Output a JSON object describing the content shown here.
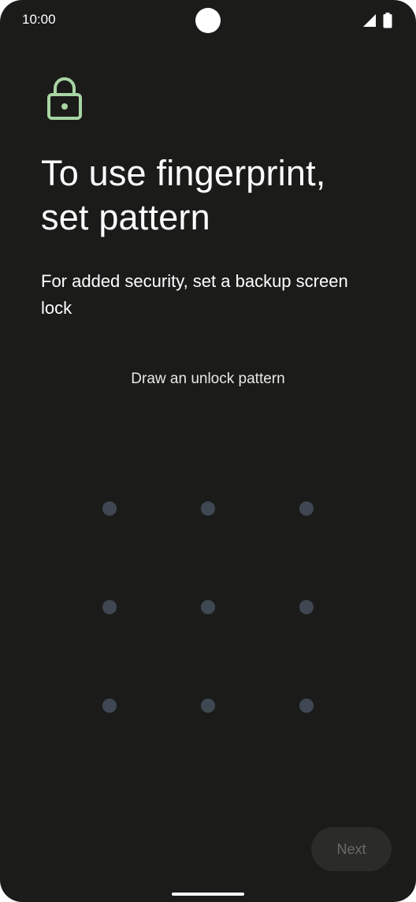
{
  "status_bar": {
    "time": "10:00",
    "icons": [
      "signal-icon",
      "battery-icon"
    ]
  },
  "header": {
    "icon": "lock-icon",
    "title_line1": "To use fingerprint,",
    "title_line2": "set pattern",
    "subtitle": "For added security, set a backup screen lock"
  },
  "pattern": {
    "instruction": "Draw an unlock pattern",
    "rows": 3,
    "cols": 3
  },
  "footer": {
    "next_label": "Next"
  },
  "colors": {
    "background": "#1b1c1a",
    "accent": "#a8d5a3",
    "dot": "#3f4852",
    "button_bg": "#2b2c2a",
    "button_text_disabled": "#6b6c69"
  }
}
